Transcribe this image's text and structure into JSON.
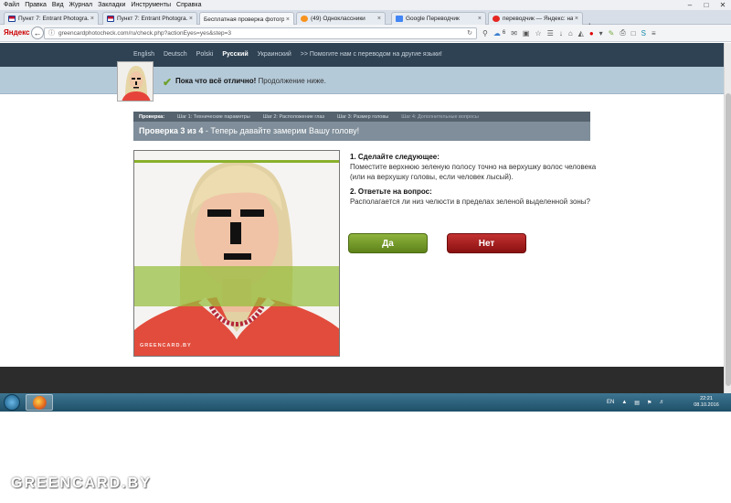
{
  "menu": [
    "Файл",
    "Правка",
    "Вид",
    "Журнал",
    "Закладки",
    "Инструменты",
    "Справка"
  ],
  "tabs": [
    {
      "label": "Пункт 7: Entrant Photogra...",
      "icon": "us-flag-icon",
      "color": "#c8102e",
      "active": false
    },
    {
      "label": "Пункт 7: Entrant Photogra...",
      "icon": "us-flag-icon",
      "color": "#c8102e",
      "active": false
    },
    {
      "label": "Бесплатная проверка фотогр...",
      "icon": "greencard-icon",
      "color": "#6a9a2a",
      "active": true
    },
    {
      "label": "(49) Одноклассники",
      "icon": "odnoklassniki-icon",
      "color": "#f7931e",
      "active": false
    },
    {
      "label": "Google Переводчик",
      "icon": "google-translate-icon",
      "color": "#4285f4",
      "active": false
    },
    {
      "label": "переводчик — Яндекс: на...",
      "icon": "yandex-icon",
      "color": "#e52620",
      "active": false
    }
  ],
  "nav": {
    "brand": "Яндекс",
    "url": "greencardphotocheck.com/ru/check.php?actionEyes=yes&step=3",
    "badge_count": "6"
  },
  "languages": [
    {
      "label": "English",
      "current": false
    },
    {
      "label": "Deutsch",
      "current": false
    },
    {
      "label": "Polski",
      "current": false
    },
    {
      "label": "Русский",
      "current": true
    },
    {
      "label": "Украинский",
      "current": false
    },
    {
      "label": ">> Помогите нам с переводом на другие языки!",
      "current": false
    }
  ],
  "status": {
    "check": "✔",
    "bold": "Пока что всё отлично!",
    "rest": "Продолжение ниже."
  },
  "steps": {
    "label": "Проверка:",
    "items": [
      {
        "label": "Шаг 1: Технические параметры",
        "state": "normal"
      },
      {
        "label": "Шаг 2: Расположение глаз",
        "state": "normal"
      },
      {
        "label": "Шаг 3: Размер головы",
        "state": "normal"
      },
      {
        "label": "Шаг 4: Дополнительные вопросы",
        "state": "done"
      }
    ]
  },
  "step_header": {
    "bold": "Проверка 3 из 4",
    "rest": " - Теперь давайте замерим Вашу голову!"
  },
  "photo": {
    "watermark": "GREENCARD.BY"
  },
  "instructions": {
    "q1_title": "1. Сделайте следующее:",
    "q1_body": "Поместите верхнюю зеленую полосу точно на верхушку волос человека (или на верхушку головы, если человек лысый).",
    "q2_title": "2. Ответьте на вопрос:",
    "q2_body": "Располагается ли низ челюсти в пределах зеленой выделенной зоны?"
  },
  "buttons": {
    "yes": "Да",
    "no": "Нет"
  },
  "taskbar": {
    "tray_lang": "EN",
    "time": "22:21",
    "date": "08.10.2016"
  },
  "watermark": "GREENCARD.BY"
}
